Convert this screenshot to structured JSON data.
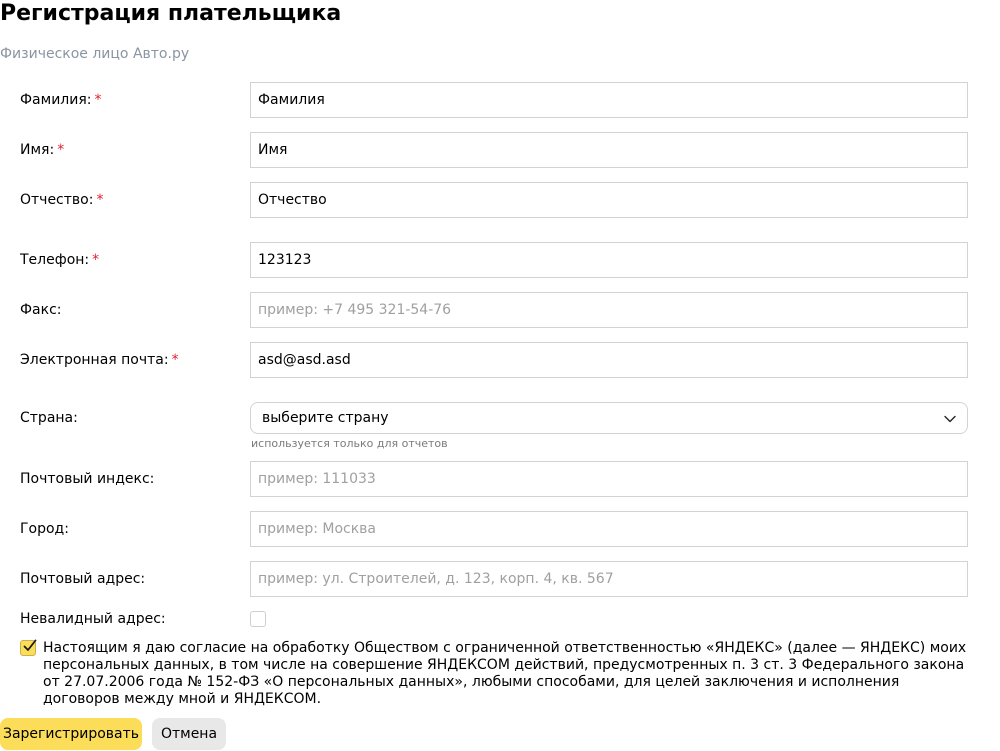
{
  "header": {
    "title": "Регистрация плательщика",
    "subtitle": "Физическое лицо Авто.ру"
  },
  "form": {
    "required_mark": "*",
    "last_name": {
      "label": "Фамилия:",
      "value": "Фамилия",
      "required": true
    },
    "first_name": {
      "label": "Имя:",
      "value": "Имя",
      "required": true
    },
    "middle_name": {
      "label": "Отчество:",
      "value": "Отчество",
      "required": true
    },
    "phone": {
      "label": "Телефон:",
      "value": "123123",
      "required": true
    },
    "fax": {
      "label": "Факс:",
      "value": "",
      "placeholder": "пример: +7 495 321-54-76",
      "required": false
    },
    "email": {
      "label": "Электронная почта:",
      "value": "asd@asd.asd",
      "required": true
    },
    "country": {
      "label": "Страна:",
      "selected": "выберите страну",
      "hint": "используется только для отчетов",
      "icon": "chevron-down-icon"
    },
    "postal_code": {
      "label": "Почтовый индекс:",
      "value": "",
      "placeholder": "пример: 111033"
    },
    "city": {
      "label": "Город:",
      "value": "",
      "placeholder": "пример: Москва"
    },
    "postal_address": {
      "label": "Почтовый адрес:",
      "value": "",
      "placeholder": "пример: ул. Строителей, д. 123, корп. 4, кв. 567"
    },
    "invalid_address": {
      "label": "Невалидный адрес:",
      "checked": false
    }
  },
  "consent": {
    "checked": true,
    "text": "Настоящим я даю согласие на обработку Обществом с ограниченной ответственностью «ЯНДЕКС» (далее — ЯНДЕКС) моих персональных данных, в том числе на совершение ЯНДЕКСОМ действий, предусмотренных п. 3 ст. 3 Федерального закона от 27.07.2006 года № 152-ФЗ «О персональных данных», любыми способами, для целей заключения и исполнения договоров между мной и ЯНДЕКСОМ."
  },
  "actions": {
    "submit_label": "Зарегистрировать",
    "cancel_label": "Отмена"
  },
  "colors": {
    "accent": "#fcdd5a",
    "required": "#e0202e",
    "subtitle": "#8a94a3",
    "border": "#d3d3d3",
    "secondary_button": "#e8e8e8"
  }
}
